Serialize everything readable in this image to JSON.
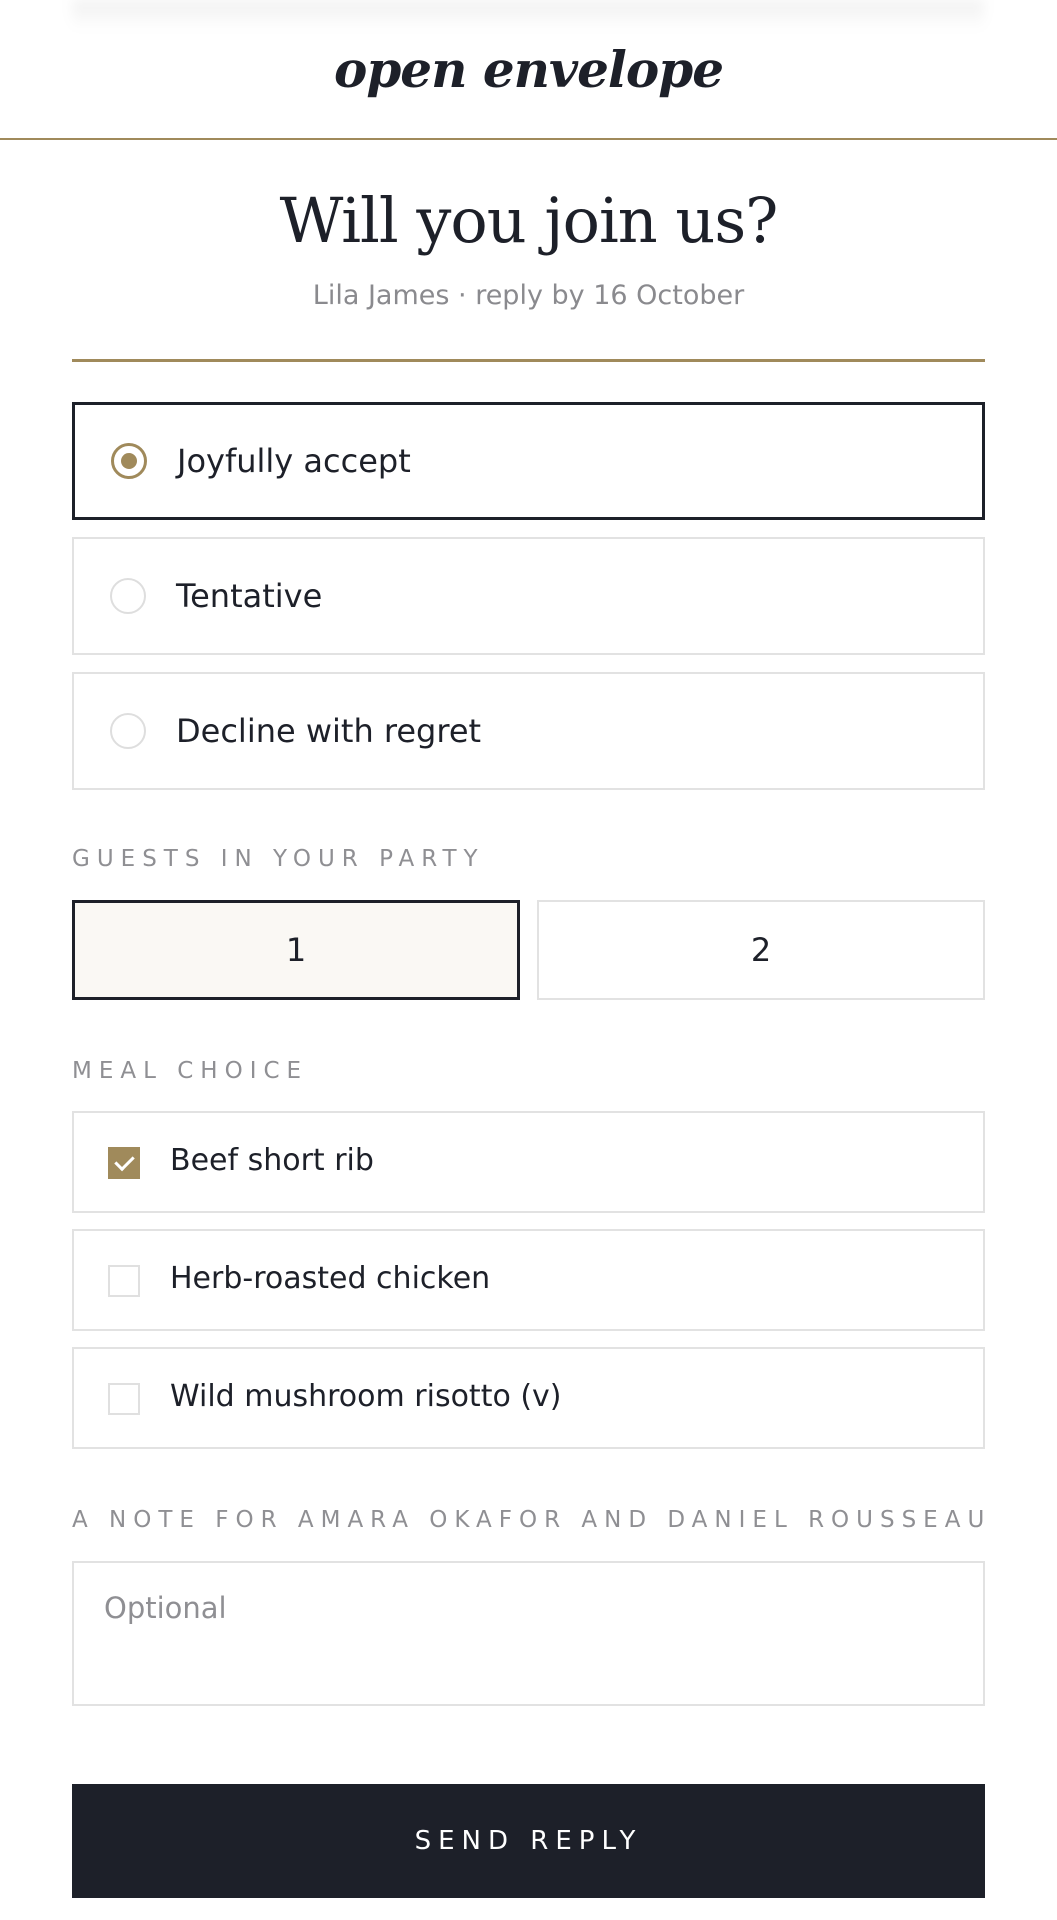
{
  "header": {
    "brand": "open envelope"
  },
  "invite": {
    "title": "Will you join us?",
    "subtitle": "Lila James · reply by 16 October"
  },
  "rsvp": {
    "options": [
      {
        "label": "Joyfully accept",
        "selected": true
      },
      {
        "label": "Tentative",
        "selected": false
      },
      {
        "label": "Decline with regret",
        "selected": false
      }
    ]
  },
  "guests": {
    "label": "GUESTS IN YOUR PARTY",
    "options": [
      {
        "label": "1",
        "selected": true
      },
      {
        "label": "2",
        "selected": false
      }
    ]
  },
  "meal": {
    "label": "MEAL CHOICE",
    "options": [
      {
        "label": "Beef short rib",
        "checked": true
      },
      {
        "label": "Herb-roasted chicken",
        "checked": false
      },
      {
        "label": "Wild mushroom risotto (v)",
        "checked": false
      }
    ]
  },
  "note": {
    "label": "A NOTE FOR AMARA OKAFOR AND DANIEL ROUSSEAU",
    "placeholder": "Optional",
    "value": ""
  },
  "submit": {
    "label": "SEND REPLY"
  },
  "colors": {
    "accent": "#a08a5b",
    "dark": "#1d2029",
    "muted": "#8f8f93",
    "border": "#e2e2e2"
  }
}
